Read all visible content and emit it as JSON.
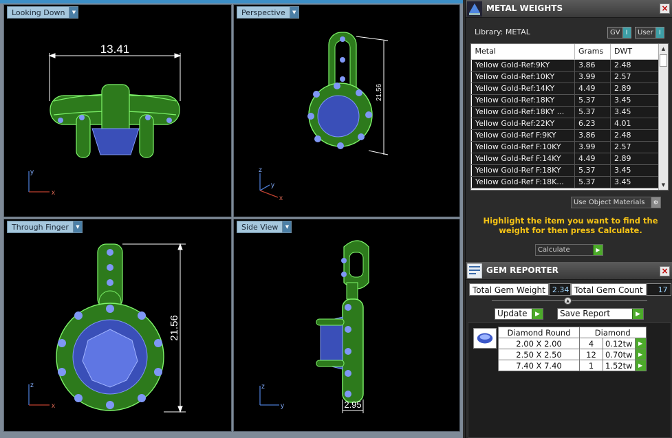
{
  "viewports": [
    {
      "id": "looking-down",
      "label": "Looking Down",
      "dimension": "13.41",
      "axes": [
        "y",
        "x"
      ]
    },
    {
      "id": "perspective",
      "label": "Perspective",
      "dimension": "21.56",
      "axes": [
        "z",
        "y",
        "x"
      ]
    },
    {
      "id": "through-finger",
      "label": "Through Finger",
      "dimension": "21.56",
      "axes": [
        "z",
        "x"
      ]
    },
    {
      "id": "side-view",
      "label": "Side View",
      "dimension": "2.95",
      "axes": [
        "z",
        "y"
      ]
    }
  ],
  "metal_weights": {
    "title": "METAL WEIGHTS",
    "library_label": "Library: METAL",
    "gv_label": "GV",
    "user_label": "User",
    "columns": [
      "Metal",
      "Grams",
      "DWT"
    ],
    "rows": [
      [
        "Yellow Gold-Ref:9KY",
        "3.86",
        "2.48"
      ],
      [
        "Yellow Gold-Ref:10KY",
        "3.99",
        "2.57"
      ],
      [
        "Yellow Gold-Ref:14KY",
        "4.49",
        "2.89"
      ],
      [
        "Yellow Gold-Ref:18KY",
        "5.37",
        "3.45"
      ],
      [
        "Yellow Gold-Ref:18KY ...",
        "5.37",
        "3.45"
      ],
      [
        "Yellow Gold-Ref:22KY",
        "6.23",
        "4.01"
      ],
      [
        "Yellow Gold-Ref F:9KY",
        "3.86",
        "2.48"
      ],
      [
        "Yellow Gold-Ref F:10KY",
        "3.99",
        "2.57"
      ],
      [
        "Yellow Gold-Ref F:14KY",
        "4.49",
        "2.89"
      ],
      [
        "Yellow Gold-Ref F:18KY",
        "5.37",
        "3.45"
      ],
      [
        "Yellow Gold-Ref F:18K...",
        "5.37",
        "3.45"
      ]
    ],
    "use_object_materials": "Use Object Materials",
    "hint": "Highlight the item you want to find the weight for then press Calculate.",
    "calculate_label": "Calculate"
  },
  "gem_reporter": {
    "title": "GEM REPORTER",
    "total_weight_label": "Total Gem Weight",
    "total_weight_value": "2.34",
    "total_count_label": "Total Gem Count",
    "total_count_value": "17",
    "update_label": "Update",
    "save_report_label": "Save Report",
    "shape_header": "Diamond Round",
    "material_header": "Diamond",
    "gems": [
      {
        "size": "2.00 X 2.00",
        "count": "4",
        "weight": "0.12tw"
      },
      {
        "size": "2.50 X 2.50",
        "count": "12",
        "weight": "0.70tw"
      },
      {
        "size": "7.40 X 7.40",
        "count": "1",
        "weight": "1.52tw"
      }
    ]
  },
  "colors": {
    "wire_green": "#7ef46a",
    "gem_blue": "#7f97f5",
    "label_bg": "#a5c7dd",
    "hint_yellow": "#f5c316",
    "accent_green": "#4caa2a"
  }
}
